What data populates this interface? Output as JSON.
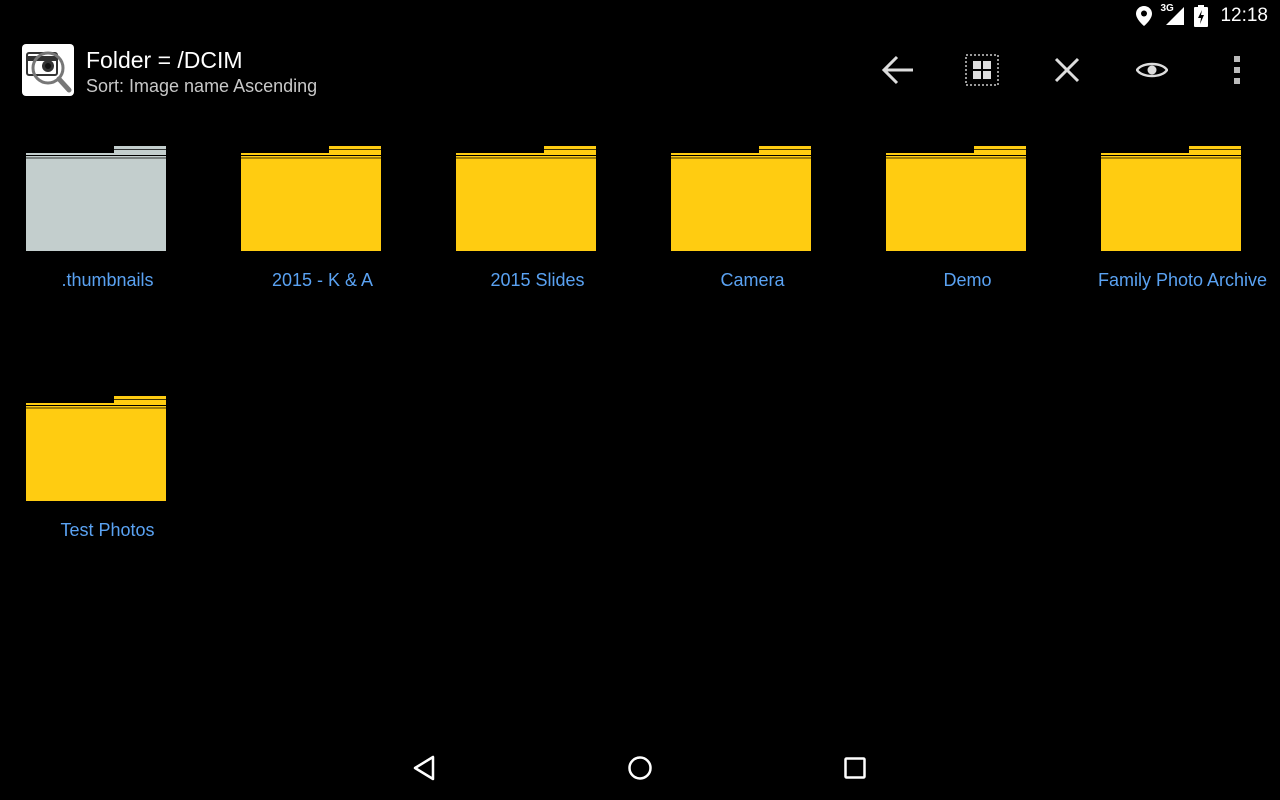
{
  "status_bar": {
    "network_label": "3G",
    "time": "12:18"
  },
  "action_bar": {
    "title": "Folder = /DCIM",
    "subtitle": "Sort: Image name Ascending",
    "app_icon": "camera-search-icon",
    "actions": [
      {
        "name": "back-arrow-icon"
      },
      {
        "name": "grid-view-icon"
      },
      {
        "name": "close-icon"
      },
      {
        "name": "eye-icon"
      },
      {
        "name": "overflow-menu-icon"
      }
    ]
  },
  "folders": [
    {
      "label": ".thumbnails",
      "color": "#c3cecd",
      "hidden": true
    },
    {
      "label": "2015 - K & A",
      "color": "#ffcc11",
      "hidden": false
    },
    {
      "label": "2015 Slides",
      "color": "#ffcc11",
      "hidden": false
    },
    {
      "label": "Camera",
      "color": "#ffcc11",
      "hidden": false
    },
    {
      "label": "Demo",
      "color": "#ffcc11",
      "hidden": false
    },
    {
      "label": "Family Photo Archive",
      "color": "#ffcc11",
      "hidden": false
    },
    {
      "label": "Test Photos",
      "color": "#ffcc11",
      "hidden": false
    }
  ],
  "nav_bar": {
    "buttons": [
      "nav-back-icon",
      "nav-home-icon",
      "nav-recents-icon"
    ]
  },
  "colors": {
    "background": "#000000",
    "folder_label": "#5aa2f2",
    "folder_yellow": "#ffcc11",
    "folder_gray": "#c3cecd"
  }
}
